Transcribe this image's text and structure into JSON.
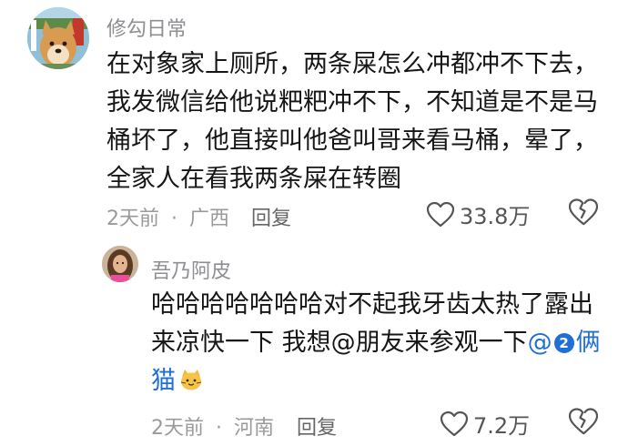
{
  "comment": {
    "username": "修勾日常",
    "lines": [
      "在对象家上厕所，两条屎怎么冲都冲不下去，",
      "我发微信给他说粑粑冲不下，不知道是不是马",
      "桶坏了，他直接叫他爸叫哥来看马桶，晕了，",
      "全家人在看我两条屎在转圈"
    ],
    "time": "2天前",
    "location": "广西",
    "reply_label": "回复",
    "like_count": "33.8万"
  },
  "reply": {
    "username": "吾乃阿皮",
    "lines": [
      "哈哈哈哈哈哈哈对不起我牙齿太热了露出",
      "来凉快一下  我想@朋友来参观一下"
    ],
    "mention": "@",
    "mention_badge": "2",
    "mention_tail": "俩",
    "last_line": "猫",
    "emoji": "cat-face",
    "time": "2天前",
    "location": "河南",
    "reply_label": "回复",
    "like_count": "7.2万"
  },
  "colors": {
    "mention": "#1f6fd6",
    "meta": "#9a9a9a",
    "text": "#161616"
  },
  "separator": "·"
}
